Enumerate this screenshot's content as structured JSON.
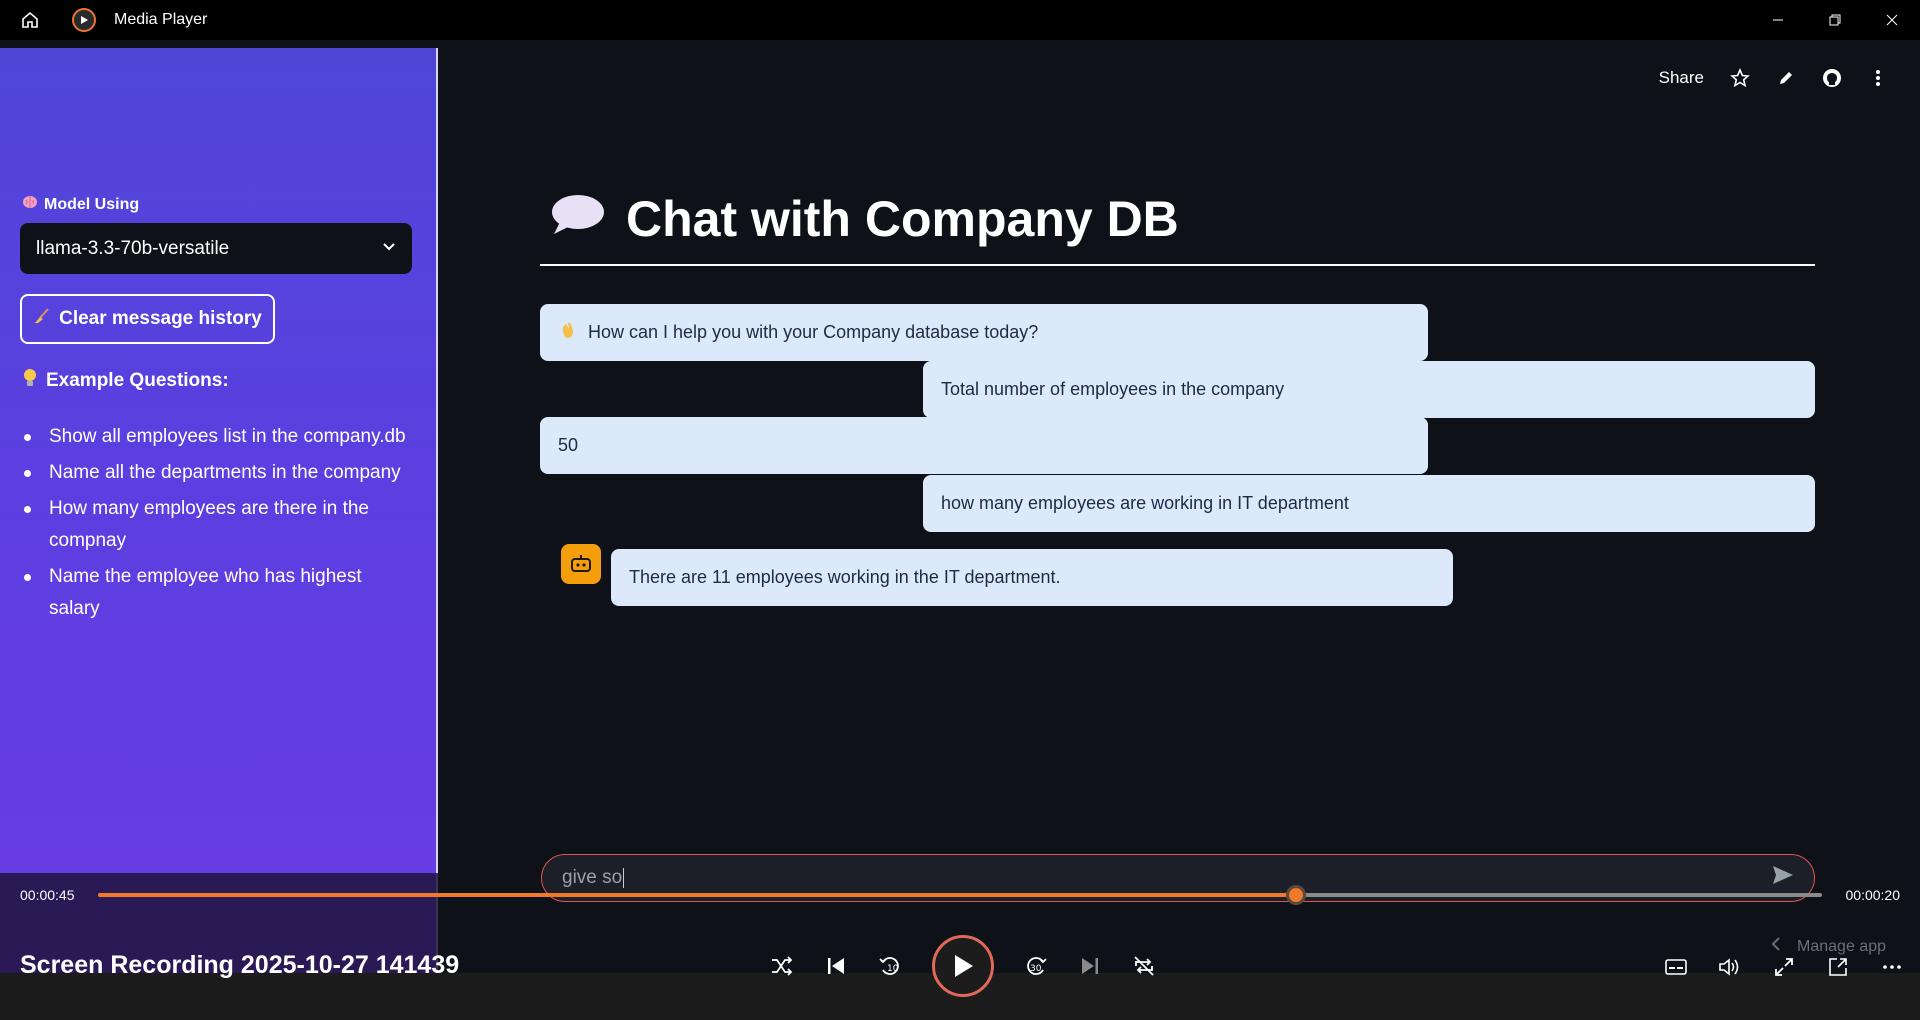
{
  "window": {
    "title": "Media Player"
  },
  "sidebar": {
    "model_label": "Model Using",
    "model_value": "llama-3.3-70b-versatile",
    "clear_button": "Clear message history",
    "examples_heading": "Example Questions:",
    "examples": [
      "Show all employees list in the company.db",
      "Name all the departments in the company",
      "How many employees are there in the compnay",
      "Name the employee who has highest salary"
    ]
  },
  "topbar": {
    "share": "Share"
  },
  "page": {
    "title": "Chat with Company DB"
  },
  "messages": [
    {
      "role": "assistant",
      "text": "How can I help you with your Company database today?"
    },
    {
      "role": "user",
      "text": "Total number of employees in the company"
    },
    {
      "role": "assistant",
      "text": "50"
    },
    {
      "role": "user",
      "text": "how many employees are working in IT department"
    },
    {
      "role": "assistant",
      "text": "There are 11 employees working in the IT department."
    }
  ],
  "chat_input": {
    "value": "give so"
  },
  "media": {
    "elapsed": "00:00:45",
    "remaining": "00:00:20",
    "progress": 0.695,
    "recording_title": "Screen Recording 2025-10-27 141439",
    "manage_app": "Manage app"
  },
  "colors": {
    "accent": "#f07a2c",
    "sidebar": "#5b3fe0",
    "bubble": "#dce9fb",
    "bot": "#f59e0b"
  }
}
